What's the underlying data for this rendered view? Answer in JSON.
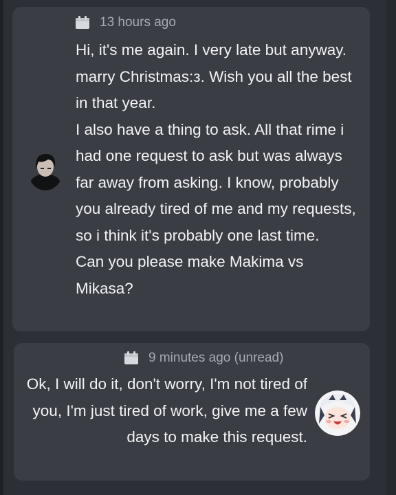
{
  "messages": [
    {
      "timestamp": "13 hours ago",
      "lines": [
        "Hi, it's me again. I very late but anyway. marry Christmas:з. Wish you all the best in that year.",
        "I also have a thing to ask. All that rime i had one request to ask but was always far away from asking. I know, probably you already tired of me and my requests, so i think it's probably one last time.",
        "Can you please make Makima vs Mikasa?"
      ]
    },
    {
      "timestamp": "9 minutes ago (unread)",
      "lines": [
        "Ok, I will do it, don't worry, I'm not tired of you, I'm just tired of work, give me a few days to make this request."
      ]
    }
  ],
  "icons": {
    "timestamp_icon": "calendar-icon"
  }
}
